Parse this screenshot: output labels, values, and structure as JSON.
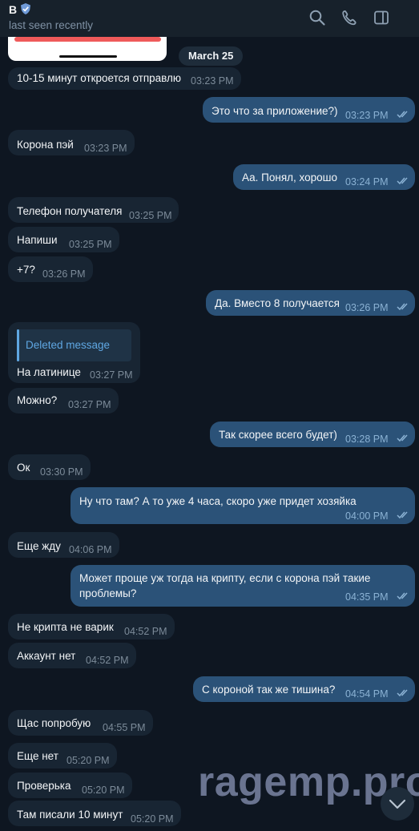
{
  "header": {
    "name": "В",
    "status": "last seen recently",
    "badge_icon": "shield-icon",
    "actions": [
      "search-icon",
      "phone-icon",
      "sidebar-toggle-icon"
    ]
  },
  "date_separator": "March 25",
  "quoted": "Deleted message",
  "messages": [
    {
      "text": "10-15 минут откроется отправлю",
      "time": "03:23 PM",
      "direction": "in"
    },
    {
      "text": "Это что за приложение?)",
      "time": "03:23 PM",
      "direction": "out"
    },
    {
      "text": "Корона пэй",
      "time": "03:23 PM",
      "direction": "in"
    },
    {
      "text": "Аа. Понял, хорошо",
      "time": "03:24 PM",
      "direction": "out"
    },
    {
      "text": "Телефон получателя",
      "time": "03:25 PM",
      "direction": "in"
    },
    {
      "text": "Напиши",
      "time": "03:25 PM",
      "direction": "in"
    },
    {
      "text": "+7?",
      "time": "03:26 PM",
      "direction": "in"
    },
    {
      "text": "Да. Вместо 8 получается",
      "time": "03:26 PM",
      "direction": "out"
    },
    {
      "text": "На латинице",
      "time": "03:27 PM",
      "direction": "in"
    },
    {
      "text": "Можно?",
      "time": "03:27 PM",
      "direction": "in"
    },
    {
      "text": "Так скорее всего будет)",
      "time": "03:28 PM",
      "direction": "out"
    },
    {
      "text": "Ок",
      "time": "03:30 PM",
      "direction": "in"
    },
    {
      "text": "Ну что там? А то уже 4 часа, скоро уже придет хозяйка",
      "time": "04:00 PM",
      "direction": "out"
    },
    {
      "text": "Еще жду",
      "time": "04:06 PM",
      "direction": "in"
    },
    {
      "text_line1": "Может проще уж тогда на крипту, если с корона пэй такие",
      "text_line2": "проблемы?",
      "time": "04:35 PM",
      "direction": "out"
    },
    {
      "text": "Не крипта не варик",
      "time": "04:52 PM",
      "direction": "in"
    },
    {
      "text": "Аккаунт нет",
      "time": "04:52 PM",
      "direction": "in"
    },
    {
      "text": "С короной так же тишина?",
      "time": "04:54 PM",
      "direction": "out"
    },
    {
      "text": "Щас попробую",
      "time": "04:55 PM",
      "direction": "in"
    },
    {
      "text": "Еще нет",
      "time": "05:20 PM",
      "direction": "in"
    },
    {
      "text": "Проверька",
      "time": "05:20 PM",
      "direction": "in"
    },
    {
      "text": "Там писали 10 минут",
      "time": "05:20 PM",
      "direction": "in"
    }
  ],
  "watermark": "ragemp.pro",
  "scroll_button_icon": "chevron-down-icon",
  "colors": {
    "background": "#0e1621",
    "header": "#17212b",
    "incoming_bubble": "#182533",
    "outgoing_bubble": "#2b5278",
    "accent": "#5fa7e3"
  }
}
